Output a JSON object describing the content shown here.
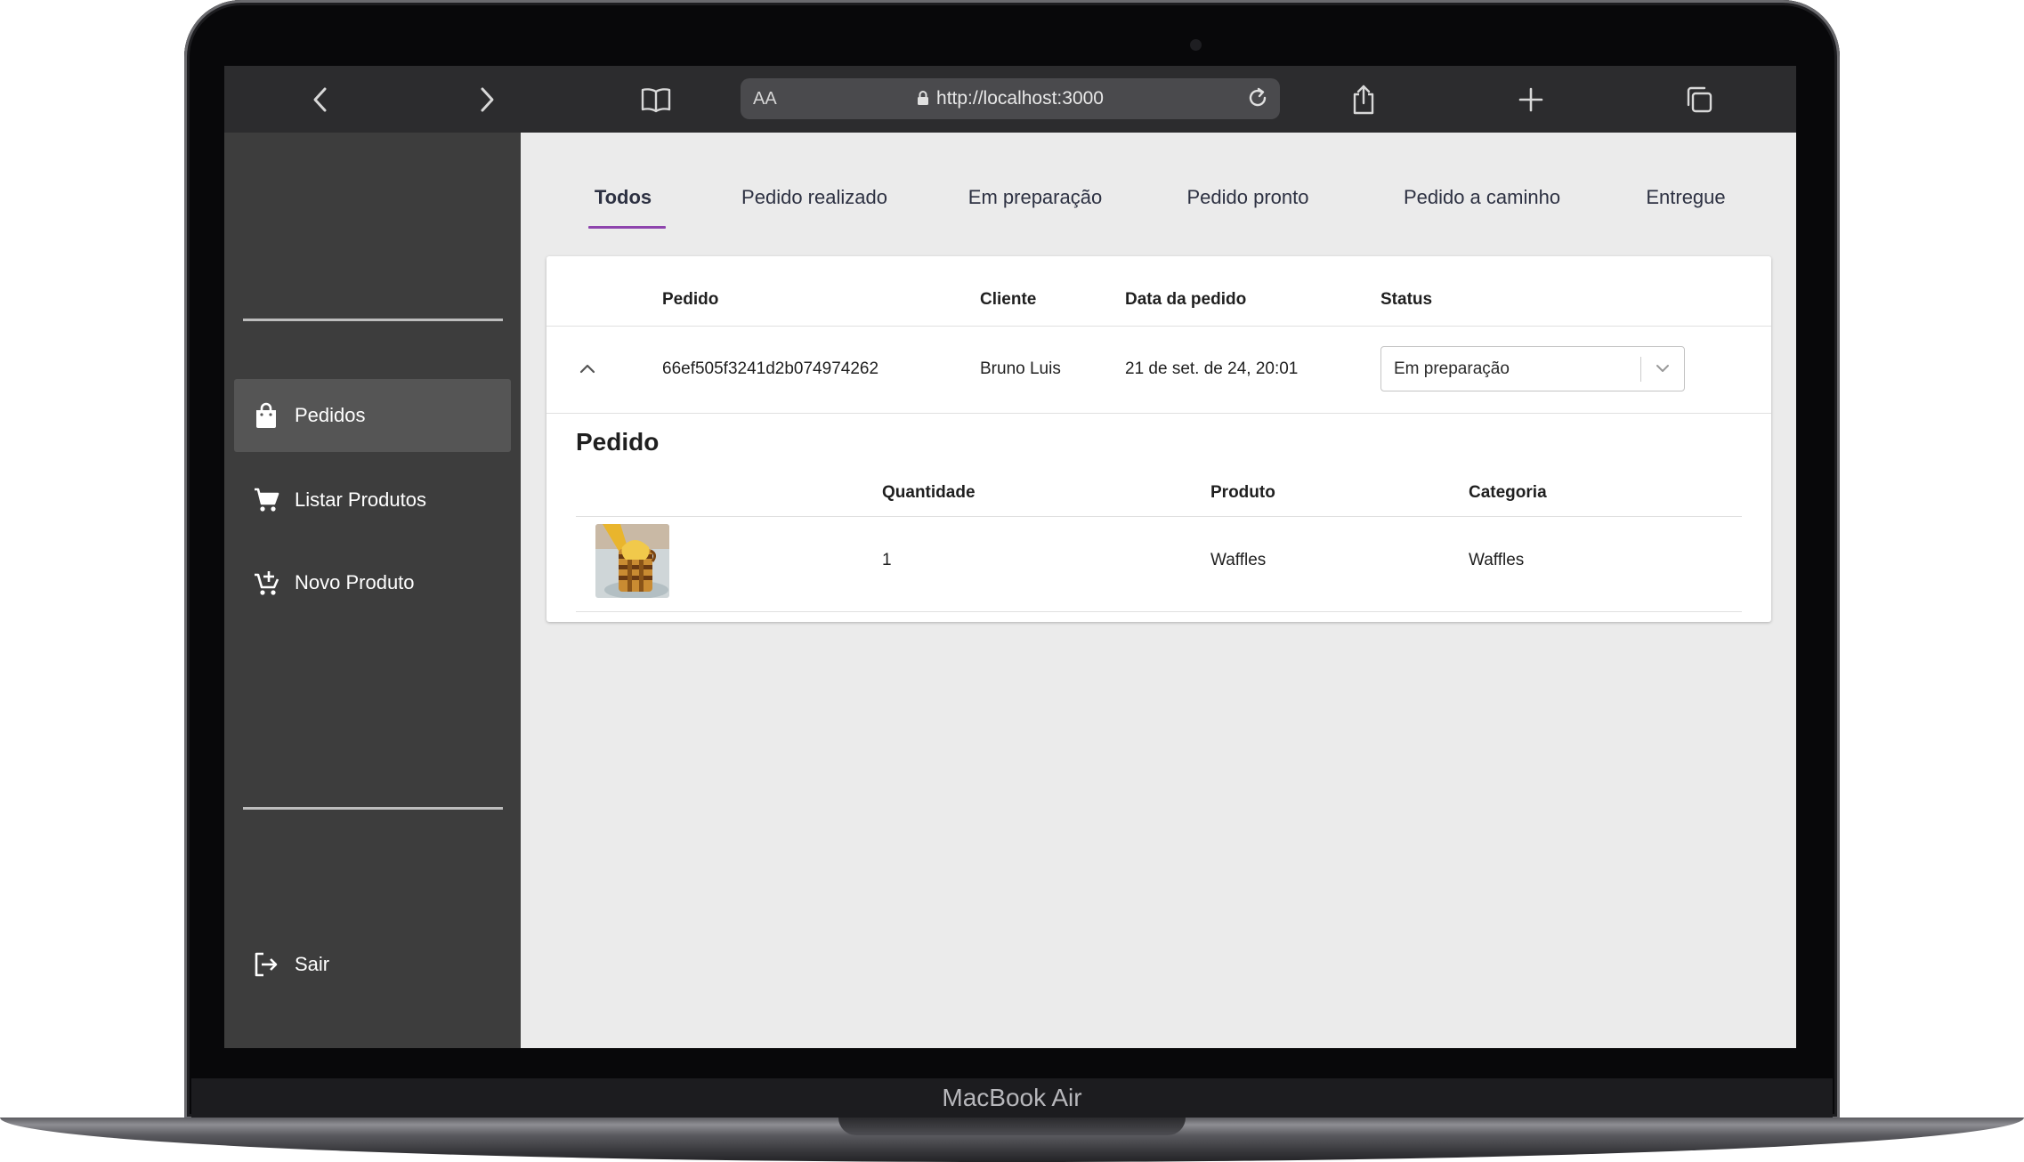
{
  "device": {
    "label": "MacBook Air"
  },
  "browser": {
    "text_size_label": "AA",
    "url": "http://localhost:3000"
  },
  "sidebar": {
    "items": [
      {
        "label": "Pedidos",
        "icon": "shopping-bag-icon",
        "active": true
      },
      {
        "label": "Listar Produtos",
        "icon": "cart-icon",
        "active": false
      },
      {
        "label": "Novo Produto",
        "icon": "add-cart-icon",
        "active": false
      }
    ],
    "logout_label": "Sair"
  },
  "tabs": [
    {
      "label": "Todos",
      "active": true
    },
    {
      "label": "Pedido realizado",
      "active": false
    },
    {
      "label": "Em preparação",
      "active": false
    },
    {
      "label": "Pedido pronto",
      "active": false
    },
    {
      "label": "Pedido a caminho",
      "active": false
    },
    {
      "label": "Entregue",
      "active": false
    }
  ],
  "orders_table": {
    "headers": [
      "Pedido",
      "Cliente",
      "Data da pedido",
      "Status"
    ],
    "rows": [
      {
        "id": "66ef505f3241d2b074974262",
        "client": "Bruno Luis",
        "date": "21 de set. de 24, 20:01",
        "status": "Em preparação",
        "expanded": true
      }
    ]
  },
  "order_detail": {
    "title": "Pedido",
    "headers": [
      "Quantidade",
      "Produto",
      "Categoria"
    ],
    "items": [
      {
        "quantity": "1",
        "product": "Waffles",
        "category": "Waffles"
      }
    ]
  },
  "colors": {
    "sidebar_bg": "#3d3d3d",
    "sidebar_active": "#555555",
    "tab_indicator": "#8e44ad",
    "browser_bar": "#2c2c2e"
  }
}
